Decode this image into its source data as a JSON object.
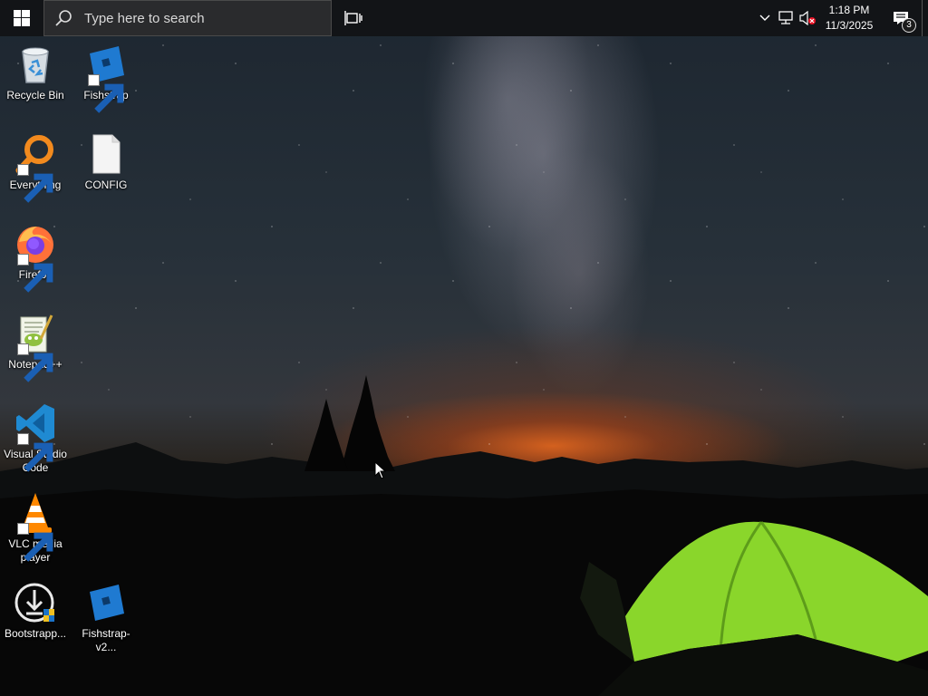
{
  "taskbar": {
    "search_placeholder": "Type here to search",
    "clock": {
      "time": "1:18 PM",
      "date": "11/3/2025"
    },
    "notification_count": "3"
  },
  "desktop_icons": [
    {
      "label": "Recycle Bin",
      "icon": "recycle-bin-icon"
    },
    {
      "label": "Fishstrap",
      "icon": "fishstrap-icon"
    },
    {
      "label": "Everything",
      "icon": "everything-search-icon"
    },
    {
      "label": "CONFIG",
      "icon": "file-icon"
    },
    {
      "label": "Firefox",
      "icon": "firefox-icon"
    },
    {
      "label": "Notepad++",
      "icon": "notepadpp-icon"
    },
    {
      "label": "Visual Studio Code",
      "icon": "vscode-icon"
    },
    {
      "label": "VLC media player",
      "icon": "vlc-icon"
    },
    {
      "label": "Bootstrapp...",
      "icon": "bootstrapper-icon"
    },
    {
      "label": "Fishstrap-v2...",
      "icon": "fishstrap-icon"
    }
  ],
  "colors": {
    "taskbar_bg": "#121417",
    "search_bg": "#2a2b2d",
    "accent_blue": "#1f7ad1",
    "tent_green": "#8ad62b"
  }
}
